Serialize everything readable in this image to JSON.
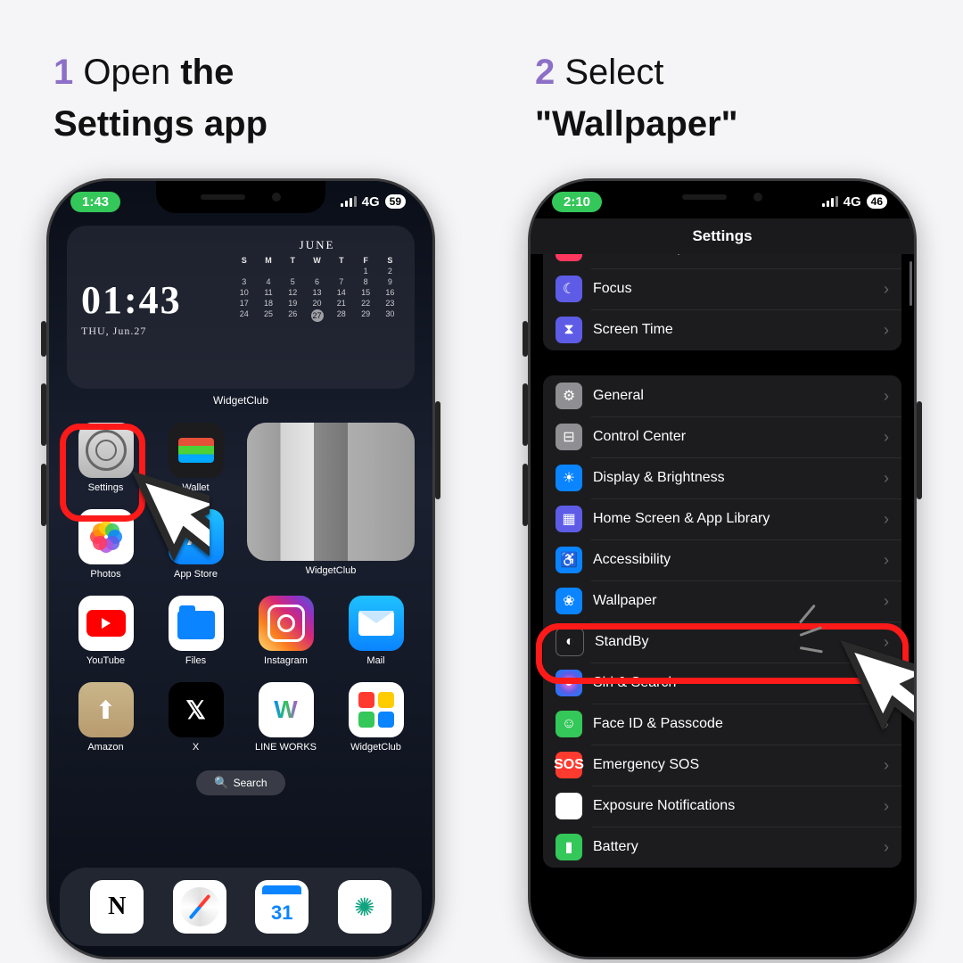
{
  "step1": {
    "number": "1",
    "action": "Open",
    "subject_line1": "the",
    "subject_line2": "Settings app"
  },
  "step2": {
    "number": "2",
    "action": "Select",
    "subject": "\"Wallpaper\""
  },
  "phone1": {
    "status": {
      "time": "1:43",
      "network": "4G",
      "battery": "59"
    },
    "widget": {
      "time": "01:43",
      "date": "THU, Jun.27",
      "month": "JUNE",
      "days": [
        "S",
        "M",
        "T",
        "W",
        "T",
        "F",
        "S"
      ],
      "dates": [
        "",
        "",
        "",
        "",
        "",
        "1",
        "2",
        "3",
        "4",
        "5",
        "6",
        "7",
        "8",
        "9",
        "10",
        "11",
        "12",
        "13",
        "14",
        "15",
        "16",
        "17",
        "18",
        "19",
        "20",
        "21",
        "22",
        "23",
        "24",
        "25",
        "26",
        "27",
        "28",
        "29",
        "30"
      ],
      "today": "27",
      "label": "WidgetClub"
    },
    "apps": {
      "settings": "Settings",
      "wallet": "Wallet",
      "widgetclub_big": "WidgetClub",
      "photos": "Photos",
      "appstore": "App Store",
      "youtube": "YouTube",
      "files": "Files",
      "instagram": "Instagram",
      "mail": "Mail",
      "amazon": "Amazon",
      "x": "X",
      "lineworks": "LINE WORKS",
      "widgetclub": "WidgetClub"
    },
    "search": "Search",
    "dock_calendar_date": "31"
  },
  "phone2": {
    "status": {
      "time": "2:10",
      "network": "4G",
      "battery": "46"
    },
    "header": "Settings",
    "sections": [
      {
        "rows": [
          {
            "icon": "sounds",
            "label": "Sounds & Haptics"
          },
          {
            "icon": "focus",
            "label": "Focus"
          },
          {
            "icon": "screentime",
            "label": "Screen Time"
          }
        ]
      },
      {
        "rows": [
          {
            "icon": "general",
            "label": "General"
          },
          {
            "icon": "control",
            "label": "Control Center"
          },
          {
            "icon": "display",
            "label": "Display & Brightness"
          },
          {
            "icon": "homescreen",
            "label": "Home Screen & App Library"
          },
          {
            "icon": "accessibility",
            "label": "Accessibility"
          },
          {
            "icon": "wallpaper",
            "label": "Wallpaper"
          },
          {
            "icon": "standby",
            "label": "StandBy"
          },
          {
            "icon": "siri",
            "label": "Siri & Search"
          },
          {
            "icon": "faceid",
            "label": "Face ID & Passcode"
          },
          {
            "icon": "sos",
            "label": "Emergency SOS"
          },
          {
            "icon": "exposure",
            "label": "Exposure Notifications"
          },
          {
            "icon": "battery",
            "label": "Battery"
          }
        ]
      }
    ]
  }
}
